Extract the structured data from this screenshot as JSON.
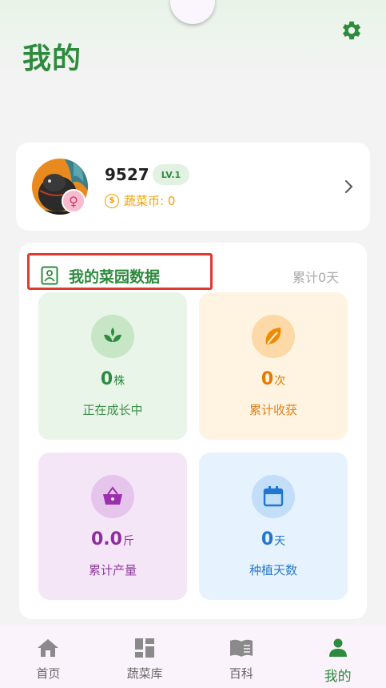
{
  "header": {
    "title": "我的",
    "settings_icon": "gear-icon",
    "accent_color": "#2e8b3e"
  },
  "profile": {
    "username": "9527",
    "level": "LV.1",
    "gender_icon": "female-icon",
    "gender_symbol": "♀",
    "coin_symbol": "$",
    "coin_label": "蔬菜币: 0"
  },
  "garden": {
    "title": "我的菜园数据",
    "total_days": "累计0天",
    "stats": [
      {
        "icon": "sprout-icon",
        "value": "0",
        "unit": "株",
        "label": "正在成长中"
      },
      {
        "icon": "leaf-icon",
        "value": "0",
        "unit": "次",
        "label": "累计收获"
      },
      {
        "icon": "basket-icon",
        "value": "0.0",
        "unit": "斤",
        "label": "累计产量"
      },
      {
        "icon": "calendar-icon",
        "value": "0",
        "unit": "天",
        "label": "种植天数"
      }
    ]
  },
  "nav": {
    "items": [
      {
        "icon": "home-icon",
        "label": "首页",
        "active": false
      },
      {
        "icon": "grid-icon",
        "label": "蔬菜库",
        "active": false
      },
      {
        "icon": "book-icon",
        "label": "百科",
        "active": false
      },
      {
        "icon": "person-icon",
        "label": "我的",
        "active": true
      }
    ]
  }
}
